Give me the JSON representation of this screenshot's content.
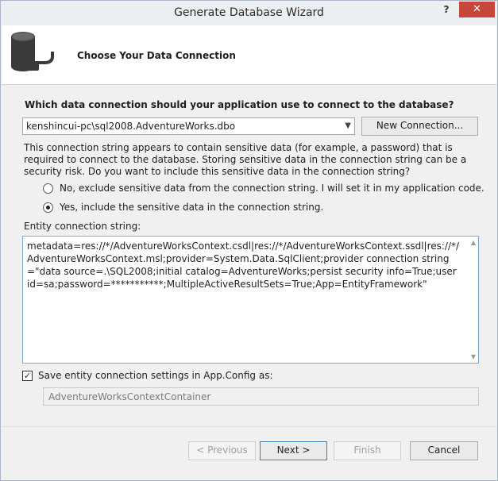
{
  "window": {
    "title": "Generate Database Wizard",
    "help_label": "?",
    "close_label": "✕"
  },
  "header": {
    "title": "Choose Your Data Connection",
    "icon": "database-plug-icon"
  },
  "connection": {
    "question": "Which data connection should your application use to connect to the database?",
    "selected": "kenshincui-pc\\sql2008.AdventureWorks.dbo",
    "new_connection_label": "New Connection..."
  },
  "sensitive": {
    "description": "This connection string appears to contain sensitive data (for example, a password) that is required to connect to the database. Storing sensitive data in the connection string can be a security risk. Do you want to include this sensitive data in the connection string?",
    "option_no": "No, exclude sensitive data from the connection string. I will set it in my application code.",
    "option_yes": "Yes, include the sensitive data in the connection string.",
    "selected": "yes"
  },
  "entity_connection": {
    "label": "Entity connection string:",
    "value": "metadata=res://*/AdventureWorksContext.csdl|res://*/AdventureWorksContext.ssdl|res://*/AdventureWorksContext.msl;provider=System.Data.SqlClient;provider connection string=\"data source=.\\SQL2008;initial catalog=AdventureWorks;persist security info=True;user id=sa;password=***********;MultipleActiveResultSets=True;App=EntityFramework\""
  },
  "save_settings": {
    "label": "Save entity connection settings in App.Config as:",
    "checked": true,
    "container_name": "AdventureWorksContextContainer"
  },
  "footer": {
    "previous_label": "< Previous",
    "next_label": "Next >",
    "finish_label": "Finish",
    "cancel_label": "Cancel"
  },
  "colors": {
    "close_button": "#c7463a",
    "focus_border": "#7aa7d6"
  }
}
